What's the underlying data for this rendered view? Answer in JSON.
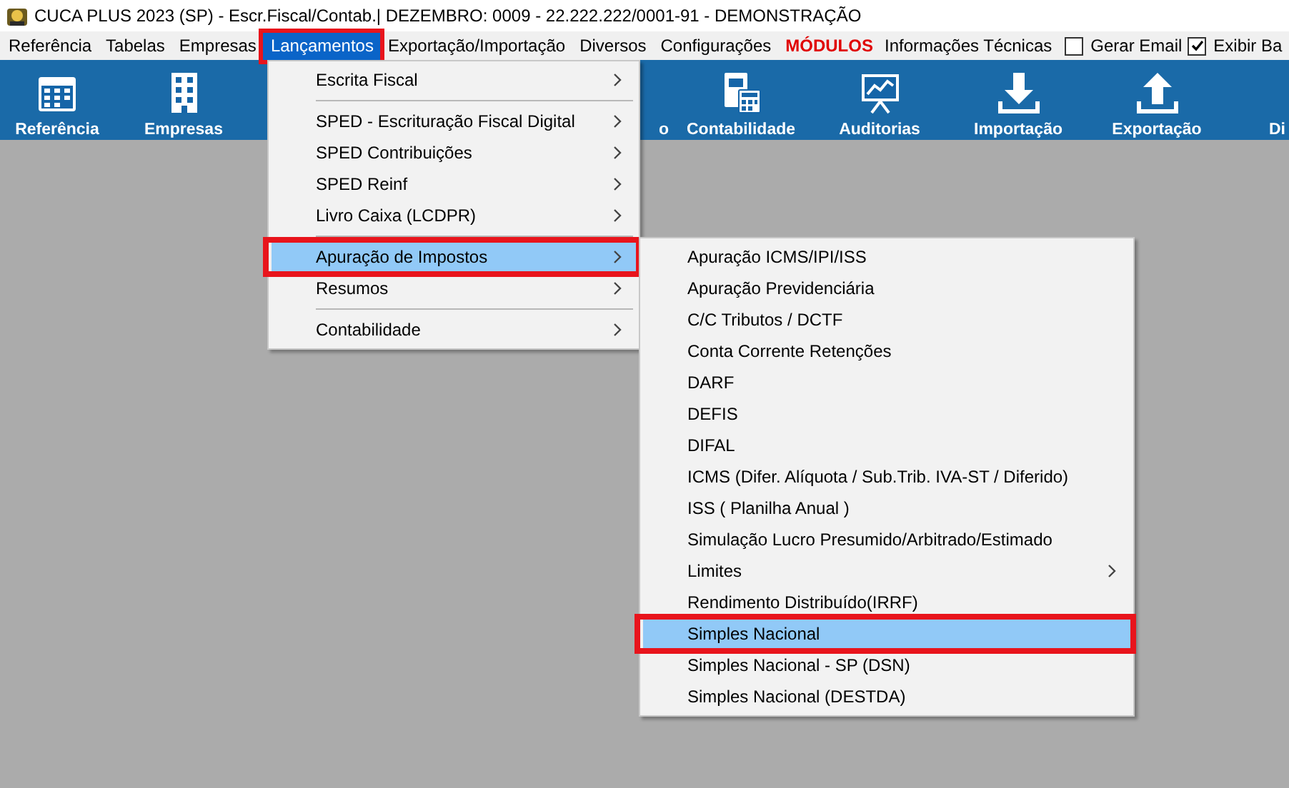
{
  "window": {
    "title": "CUCA PLUS 2023 (SP) - Escr.Fiscal/Contab.| DEZEMBRO: 0009 - 22.222.222/0001-91 - DEMONSTRAÇÃO"
  },
  "menu_bar": [
    {
      "label": "Referência",
      "selected": false,
      "kind": "menu"
    },
    {
      "label": "Tabelas",
      "selected": false,
      "kind": "menu"
    },
    {
      "label": "Empresas",
      "selected": false,
      "kind": "menu"
    },
    {
      "label": "Lançamentos",
      "selected": true,
      "kind": "menu",
      "annotated": true
    },
    {
      "label": "Exportação/Importação",
      "selected": false,
      "kind": "menu"
    },
    {
      "label": "Diversos",
      "selected": false,
      "kind": "menu"
    },
    {
      "label": "Configurações",
      "selected": false,
      "kind": "menu"
    },
    {
      "label": "MÓDULOS",
      "selected": false,
      "kind": "highlight"
    },
    {
      "label": "Informações Técnicas",
      "selected": false,
      "kind": "menu"
    },
    {
      "label": "Gerar Email",
      "checked": false,
      "kind": "checkbox"
    },
    {
      "label": "Exibir Ba",
      "checked": true,
      "kind": "checkbox"
    }
  ],
  "toolbar": [
    {
      "label": "Referência",
      "kind": "calendar"
    },
    {
      "label": "Empresas",
      "kind": "building"
    },
    {
      "kind": "covered"
    },
    {
      "kind": "covered"
    },
    {
      "label": "o",
      "kind": "partial"
    },
    {
      "label": "Contabilidade",
      "kind": "calculator"
    },
    {
      "label": "Auditorias",
      "kind": "chart"
    },
    {
      "label": "Importação",
      "kind": "download"
    },
    {
      "label": "Exportação",
      "kind": "upload"
    },
    {
      "label": "Di",
      "kind": "cut"
    }
  ],
  "menu": [
    {
      "label": "Escrita Fiscal",
      "submenu": true,
      "selected": false,
      "separator_after": true
    },
    {
      "label": "SPED - Escrituração Fiscal Digital",
      "submenu": true,
      "selected": false
    },
    {
      "label": "SPED Contribuições",
      "submenu": true,
      "selected": false
    },
    {
      "label": "SPED Reinf",
      "submenu": true,
      "selected": false
    },
    {
      "label": "Livro Caixa (LCDPR)",
      "submenu": true,
      "selected": false,
      "separator_after": true
    },
    {
      "label": "Apuração de Impostos",
      "submenu": true,
      "selected": true,
      "annotated": true
    },
    {
      "label": "Resumos",
      "submenu": true,
      "selected": false,
      "separator_after": true
    },
    {
      "label": "Contabilidade",
      "submenu": true,
      "selected": false
    }
  ],
  "submenu": [
    {
      "label": "Apuração ICMS/IPI/ISS",
      "submenu": false,
      "selected": false
    },
    {
      "label": "Apuração Previdenciária",
      "submenu": false,
      "selected": false
    },
    {
      "label": "C/C Tributos / DCTF",
      "submenu": false,
      "selected": false
    },
    {
      "label": "Conta Corrente Retenções",
      "submenu": false,
      "selected": false
    },
    {
      "label": "DARF",
      "submenu": false,
      "selected": false
    },
    {
      "label": "DEFIS",
      "submenu": false,
      "selected": false
    },
    {
      "label": "DIFAL",
      "submenu": false,
      "selected": false
    },
    {
      "label": "ICMS (Difer. Alíquota / Sub.Trib. IVA-ST / Diferido)",
      "submenu": false,
      "selected": false
    },
    {
      "label": "ISS ( Planilha Anual )",
      "submenu": false,
      "selected": false
    },
    {
      "label": "Simulação Lucro Presumido/Arbitrado/Estimado",
      "submenu": false,
      "selected": false
    },
    {
      "label": "Limites",
      "submenu": true,
      "selected": false
    },
    {
      "label": "Rendimento Distribuído(IRRF)",
      "submenu": false,
      "selected": false
    },
    {
      "label": "Simples Nacional",
      "submenu": false,
      "selected": true,
      "annotated": true
    },
    {
      "label": "Simples Nacional - SP (DSN)",
      "submenu": false,
      "selected": false
    },
    {
      "label": "Simples Nacional  (DESTDA)",
      "submenu": false,
      "selected": false
    }
  ]
}
